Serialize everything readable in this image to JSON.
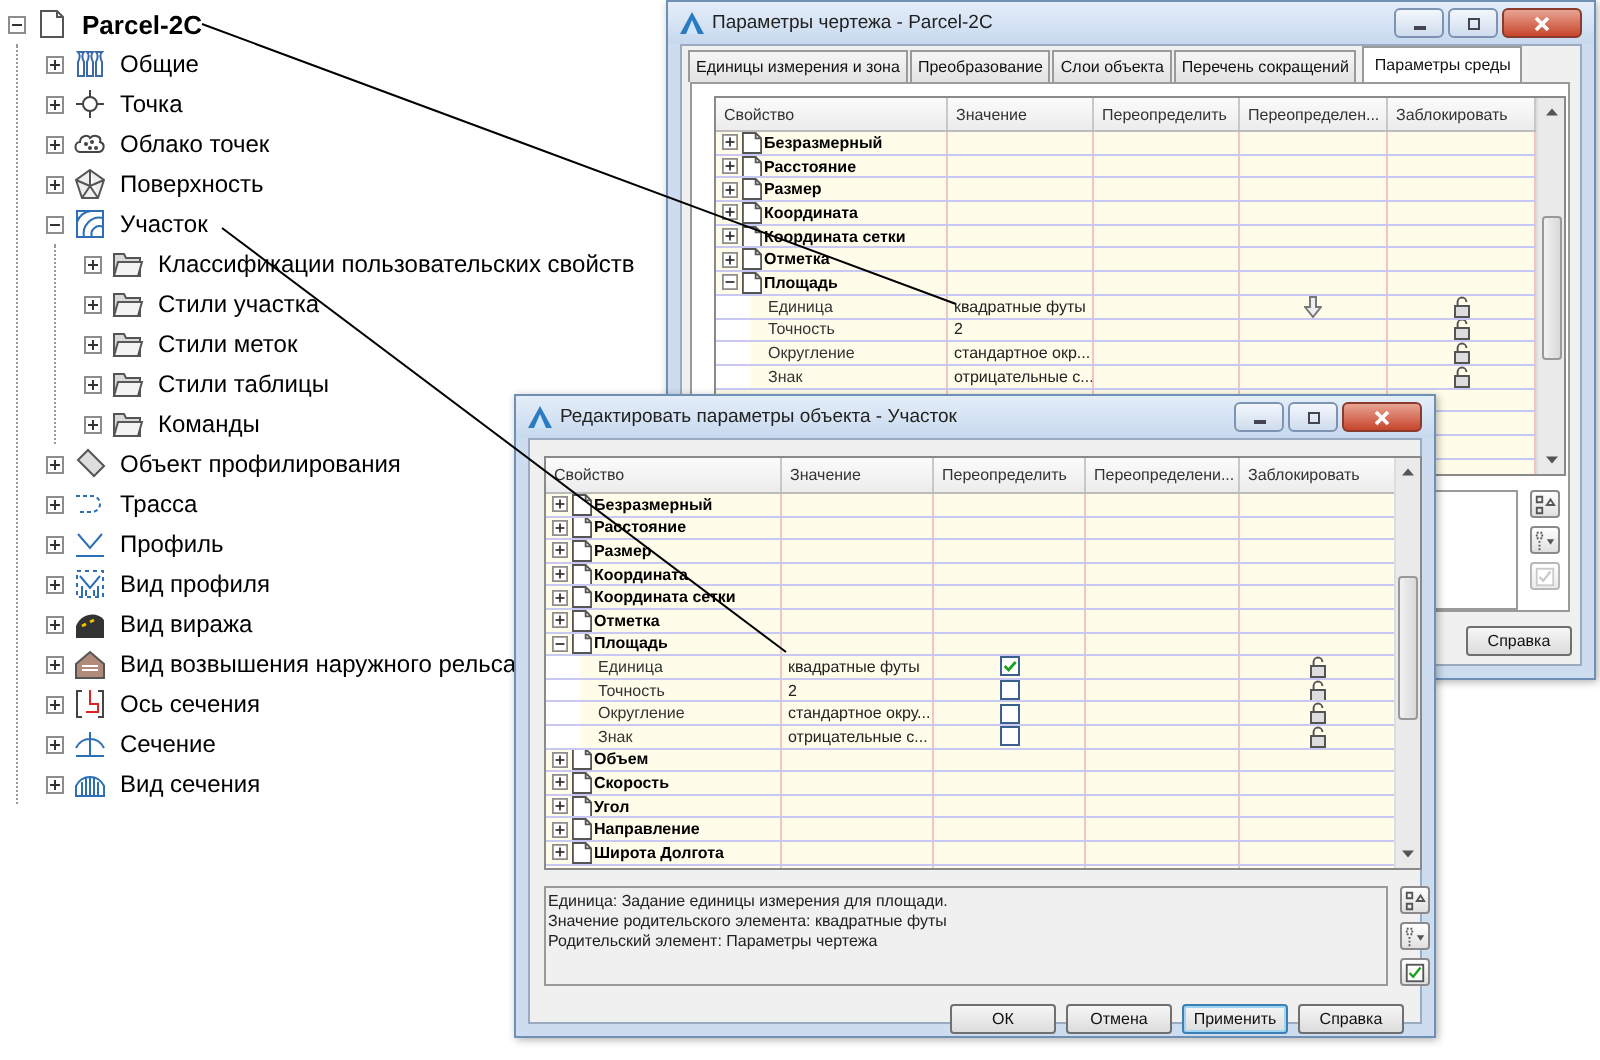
{
  "tree": {
    "label": "Parcel-2C",
    "kind": "drawing",
    "expanded": true,
    "children": [
      {
        "label": "Общие",
        "kind": "general",
        "expanded": false
      },
      {
        "label": "Точка",
        "kind": "point",
        "expanded": false
      },
      {
        "label": "Облако точек",
        "kind": "point-cloud",
        "expanded": false
      },
      {
        "label": "Поверхность",
        "kind": "surface",
        "expanded": false
      },
      {
        "label": "Участок",
        "kind": "parcel",
        "expanded": true,
        "children": [
          {
            "label": "Классификации пользовательских свойств",
            "kind": "folder",
            "expanded": false
          },
          {
            "label": "Стили участка",
            "kind": "folder",
            "expanded": false
          },
          {
            "label": "Стили меток",
            "kind": "folder",
            "expanded": false
          },
          {
            "label": "Стили таблицы",
            "kind": "folder",
            "expanded": false
          },
          {
            "label": "Команды",
            "kind": "folder",
            "expanded": false
          }
        ]
      },
      {
        "label": "Объект профилирования",
        "kind": "grading",
        "expanded": false
      },
      {
        "label": "Трасса",
        "kind": "alignment",
        "expanded": false
      },
      {
        "label": "Профиль",
        "kind": "profile",
        "expanded": false
      },
      {
        "label": "Вид профиля",
        "kind": "profile-view",
        "expanded": false
      },
      {
        "label": "Вид виража",
        "kind": "superelevation",
        "expanded": false
      },
      {
        "label": "Вид возвышения наружного рельса",
        "kind": "cant",
        "expanded": false
      },
      {
        "label": "Ось сечения",
        "kind": "sample-line",
        "expanded": false
      },
      {
        "label": "Сечение",
        "kind": "section",
        "expanded": false
      },
      {
        "label": "Вид сечения",
        "kind": "section-view",
        "expanded": false
      }
    ]
  },
  "drawing_settings_dialog": {
    "title": "Параметры чертежа - Parcel-2C",
    "tabs": [
      {
        "label": "Единицы измерения и зона",
        "selected": false
      },
      {
        "label": "Преобразование",
        "selected": false
      },
      {
        "label": "Слои объекта",
        "selected": false
      },
      {
        "label": "Перечень сокращений",
        "selected": false
      },
      {
        "label": "Параметры среды",
        "selected": true
      }
    ],
    "columns": [
      "Свойство",
      "Значение",
      "Переопределить",
      "Переопределен...",
      "Заблокировать"
    ],
    "rows": [
      {
        "label": "Безразмерный",
        "expanded": false
      },
      {
        "label": "Расстояние",
        "expanded": false
      },
      {
        "label": "Размер",
        "expanded": false
      },
      {
        "label": "Координата",
        "expanded": false
      },
      {
        "label": "Координата сетки",
        "expanded": false
      },
      {
        "label": "Отметка",
        "expanded": false
      },
      {
        "label": "Площадь",
        "expanded": true,
        "children": [
          {
            "label": "Единица",
            "value": "квадратные футы",
            "child_override": true,
            "locked": false
          },
          {
            "label": "Точность",
            "value": "2",
            "child_override": false,
            "locked": false
          },
          {
            "label": "Округление",
            "value": "стандартное окр...",
            "child_override": false,
            "locked": false
          },
          {
            "label": "Знак",
            "value": "отрицательные с...",
            "child_override": false,
            "locked": false
          }
        ]
      }
    ],
    "buttons": [
      "Справка"
    ]
  },
  "object_settings_dialog": {
    "title": "Редактировать параметры объекта - Участок",
    "columns": [
      "Свойство",
      "Значение",
      "Переопределить",
      "Переопределени...",
      "Заблокировать"
    ],
    "rows": [
      {
        "label": "Безразмерный",
        "expanded": false
      },
      {
        "label": "Расстояние",
        "expanded": false
      },
      {
        "label": "Размер",
        "expanded": false
      },
      {
        "label": "Координата",
        "expanded": false
      },
      {
        "label": "Координата сетки",
        "expanded": false
      },
      {
        "label": "Отметка",
        "expanded": false
      },
      {
        "label": "Площадь",
        "expanded": true,
        "children": [
          {
            "label": "Единица",
            "value": "квадратные футы",
            "override": true,
            "locked": false
          },
          {
            "label": "Точность",
            "value": "2",
            "override": false,
            "locked": false
          },
          {
            "label": "Округление",
            "value": "стандартное окру...",
            "override": false,
            "locked": false
          },
          {
            "label": "Знак",
            "value": "отрицательные с...",
            "override": false,
            "locked": false
          }
        ]
      },
      {
        "label": "Объем",
        "expanded": false
      },
      {
        "label": "Скорость",
        "expanded": false
      },
      {
        "label": "Угол",
        "expanded": false
      },
      {
        "label": "Направление",
        "expanded": false
      },
      {
        "label": "Широта Долгота",
        "expanded": false
      }
    ],
    "description": [
      "Единица: Задание единицы измерения для площади.",
      "Значение родительского элемента: квадратные футы",
      "Родительский элемент: Параметры чертежа"
    ],
    "buttons": [
      {
        "label": "ОК",
        "focused": false
      },
      {
        "label": "Отмена",
        "focused": false
      },
      {
        "label": "Применить",
        "focused": true
      },
      {
        "label": "Справка",
        "focused": false
      }
    ]
  }
}
